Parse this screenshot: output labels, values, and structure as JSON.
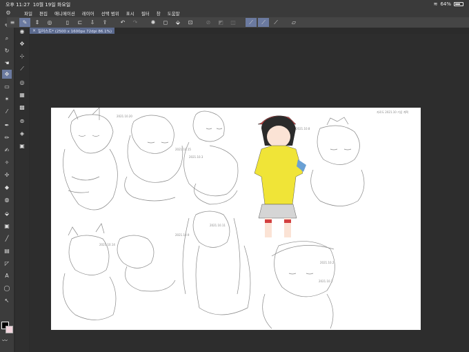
{
  "status_bar": {
    "time": "오후 11:27",
    "date": "10월 19일 화요일",
    "battery": "64%"
  },
  "menu": {
    "items": [
      "파일",
      "편집",
      "애니메이션",
      "레이어",
      "선택 범위",
      "표시",
      "필터",
      "창",
      "도움말"
    ]
  },
  "command_bar": {
    "buttons": [
      "menu-icon",
      "brush-settings-icon",
      "dropdown-icon",
      "clip-studio-icon",
      "new-icon",
      "open-icon",
      "save-icon",
      "export-icon",
      "undo-icon",
      "redo-icon",
      "loading-icon",
      "clear-icon",
      "fill-icon",
      "transform-icon",
      "deselect-icon",
      "invert-icon",
      "clear-outside-icon",
      "fill-selection-icon",
      "snap-ruler-icon",
      "snap-special-icon",
      "snap-grid-icon",
      "more-icon"
    ]
  },
  "document_tab": {
    "title": "일러스트* (2500 x 1600px 72dpi 86.1%)"
  },
  "colors": {
    "main_color": "#000000",
    "sub_color": "#f1d4dc",
    "accent": "#6b7aa0"
  },
  "canvas_notes": {
    "note1": "2021.10.20",
    "note2": "2021.10.15",
    "note3": "2021.10.3",
    "note4": "2021.10.8",
    "note5": "2021.10.14",
    "note6": "2021.10.9",
    "note7": "2021.10.2",
    "note8": "2021.10.1",
    "note9": "2021.10.11",
    "header_note": "자료도 2021.10 기념 계획"
  }
}
